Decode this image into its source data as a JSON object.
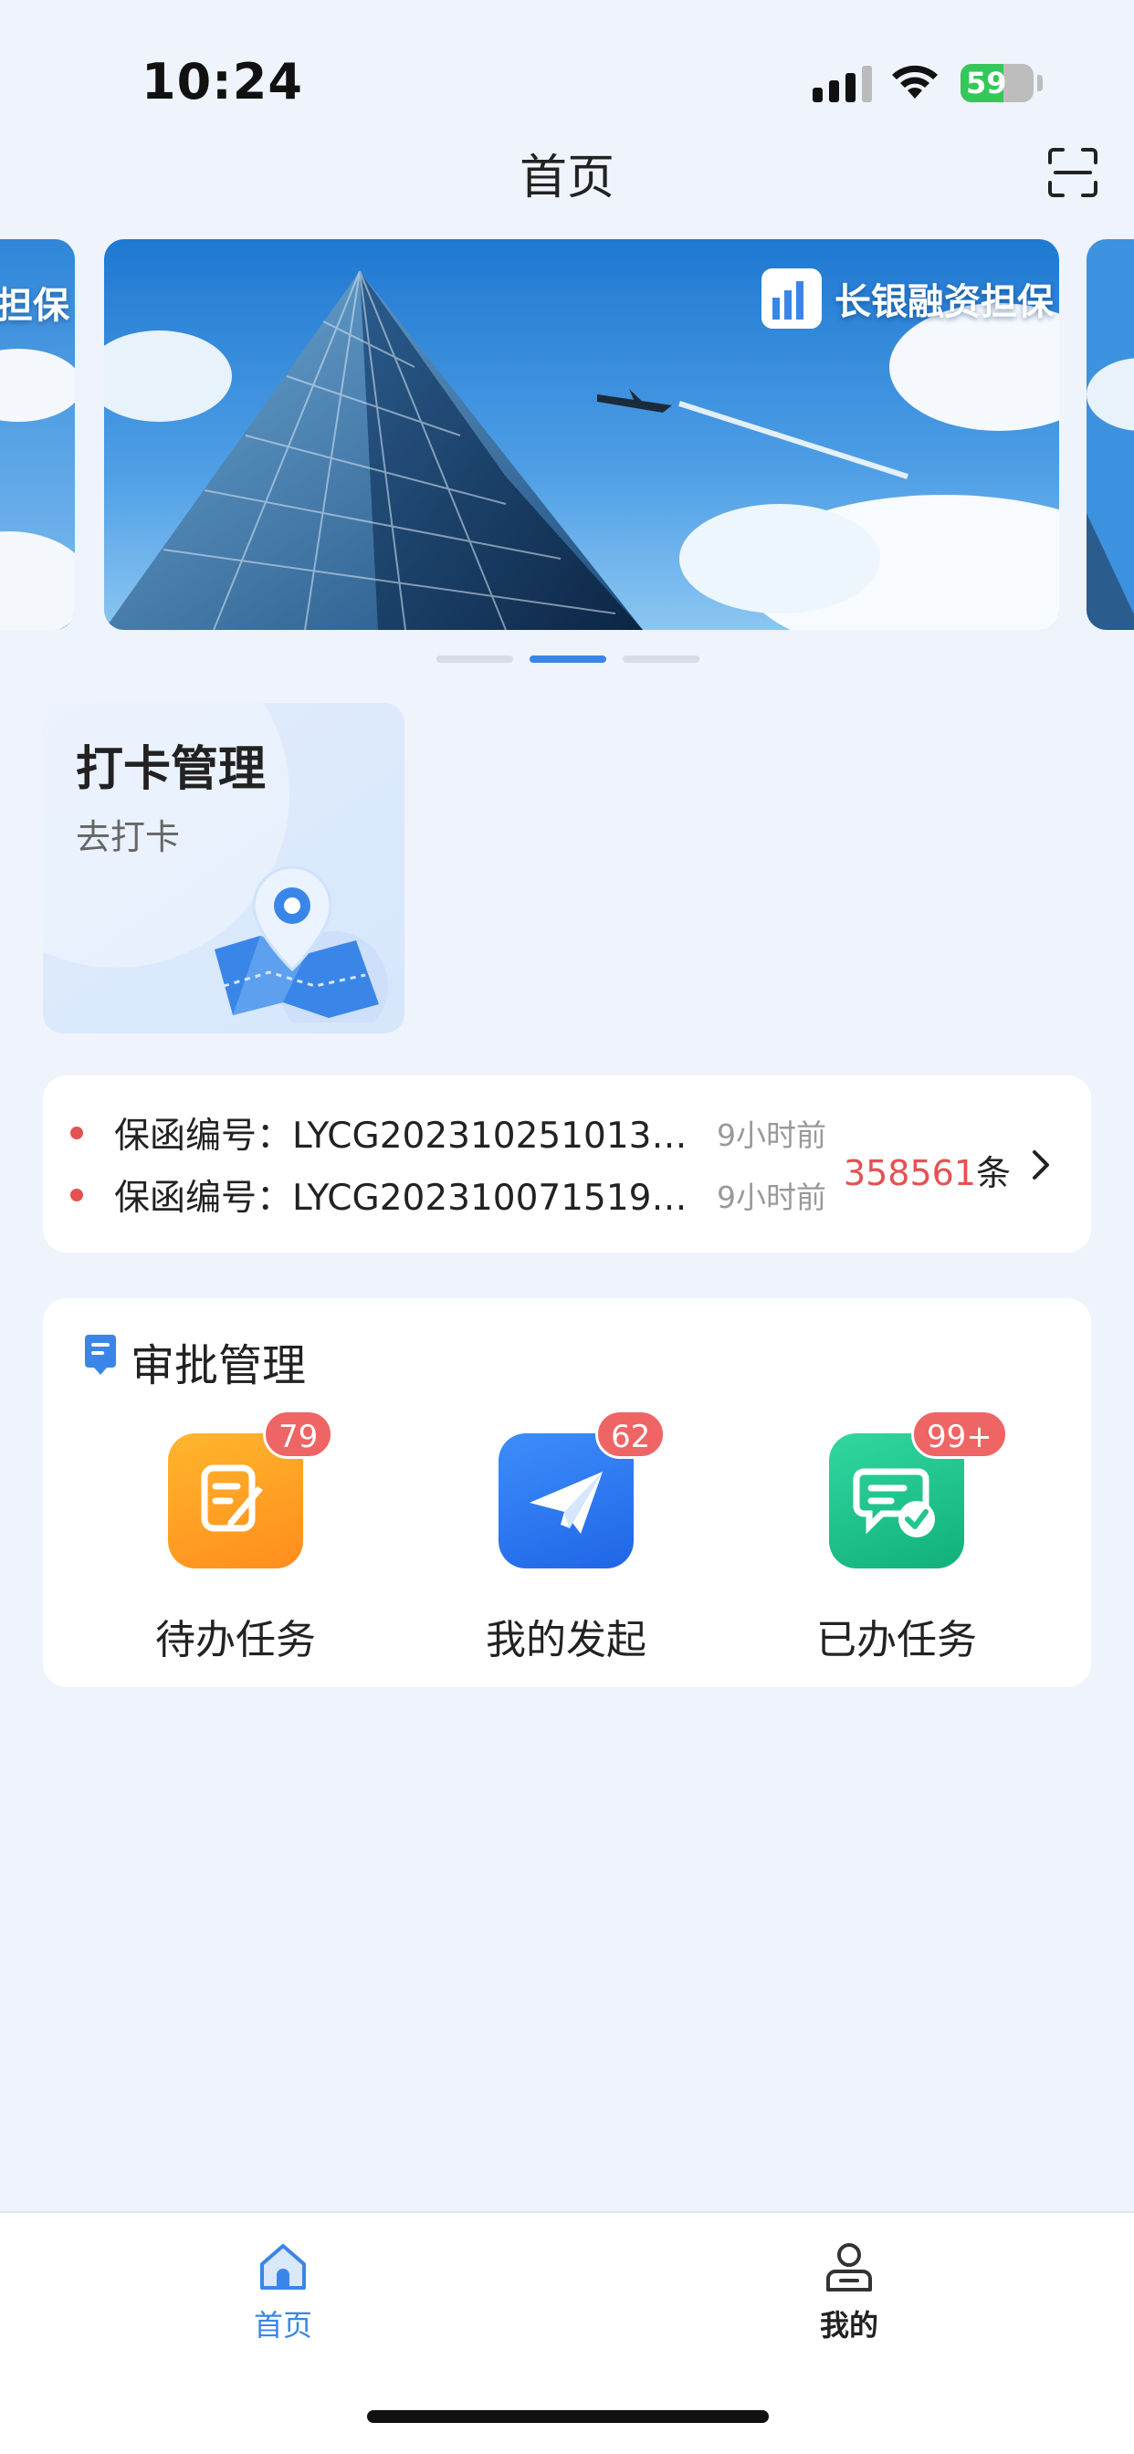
{
  "status_bar": {
    "time": "10:24",
    "battery_percent": "59",
    "battery_level": 0.59,
    "icons": [
      "signal-icon",
      "wifi-icon",
      "battery-icon"
    ]
  },
  "nav": {
    "title": "首页",
    "scan_icon": "scan-icon"
  },
  "banner": {
    "brand_name": "长银融资担保",
    "prev_slide_text": "担保",
    "slide_count": 3,
    "active_slide": 2
  },
  "checkin": {
    "title": "打卡管理",
    "subtitle": "去打卡",
    "icon": "map-pin-icon"
  },
  "notices": {
    "items": [
      {
        "text": "保函编号：LYCG2023102510131…",
        "time": "9小时前"
      },
      {
        "text": "保函编号：LYCG202310071519…",
        "time": "9小时前"
      }
    ],
    "count_number": "358561",
    "count_unit": "条"
  },
  "approval": {
    "title": "审批管理",
    "tiles": [
      {
        "label": "待办任务",
        "badge": "79",
        "icon": "edit-icon",
        "color": "#ff9f24"
      },
      {
        "label": "我的发起",
        "badge": "62",
        "icon": "send-icon",
        "color": "#2f7cf6"
      },
      {
        "label": "已办任务",
        "badge": "99+",
        "icon": "message-check-icon",
        "color": "#1fc690"
      }
    ]
  },
  "tabbar": {
    "tabs": [
      {
        "label": "首页",
        "icon": "home-icon",
        "active": true
      },
      {
        "label": "我的",
        "icon": "user-icon",
        "active": false
      }
    ],
    "accent_color": "#3a86e8"
  }
}
